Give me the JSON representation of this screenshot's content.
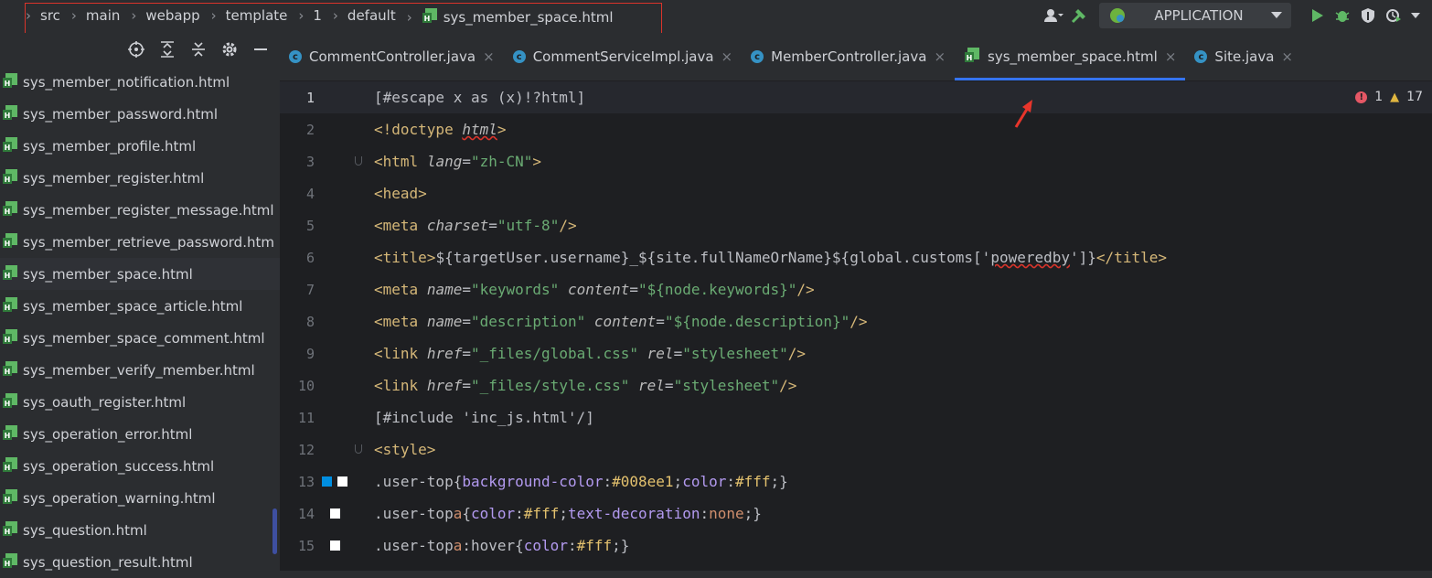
{
  "breadcrumbs": [
    "src",
    "main",
    "webapp",
    "template",
    "1",
    "default",
    "sys_member_space.html"
  ],
  "toolbar": {
    "run_config": "APPLICATION"
  },
  "sidebar": {
    "items": [
      "sys_member_notification.html",
      "sys_member_password.html",
      "sys_member_profile.html",
      "sys_member_register.html",
      "sys_member_register_message.html",
      "sys_member_retrieve_password.htm",
      "sys_member_space.html",
      "sys_member_space_article.html",
      "sys_member_space_comment.html",
      "sys_member_verify_member.html",
      "sys_oauth_register.html",
      "sys_operation_error.html",
      "sys_operation_success.html",
      "sys_operation_warning.html",
      "sys_question.html",
      "sys_question_result.html"
    ],
    "selected_index": 6
  },
  "tabs": [
    {
      "label": "CommentController.java",
      "type": "class"
    },
    {
      "label": "CommentServiceImpl.java",
      "type": "class"
    },
    {
      "label": "MemberController.java",
      "type": "class"
    },
    {
      "label": "sys_member_space.html",
      "type": "html"
    },
    {
      "label": "Site.java",
      "type": "class"
    }
  ],
  "active_tab": 3,
  "inspections": {
    "errors": "1",
    "warnings": "17"
  },
  "code_lines": [
    {
      "n": "1",
      "t": "[#escape x as (x)!?html]"
    },
    {
      "n": "2",
      "t": "<!doctype html>"
    },
    {
      "n": "3",
      "t": "<html lang=\"zh-CN\">"
    },
    {
      "n": "4",
      "t": "<head>"
    },
    {
      "n": "5",
      "t": "<meta charset=\"utf-8\"/>"
    },
    {
      "n": "6",
      "t": "<title>${targetUser.username}_${site.fullNameOrName}${global.customs['poweredby']}</title>"
    },
    {
      "n": "7",
      "t": "<meta name=\"keywords\" content=\"${node.keywords}\"/>"
    },
    {
      "n": "8",
      "t": "<meta name=\"description\" content=\"${node.description}\"/>"
    },
    {
      "n": "9",
      "t": "<link href=\"_files/global.css\" rel=\"stylesheet\"/>"
    },
    {
      "n": "10",
      "t": "<link href=\"_files/style.css\" rel=\"stylesheet\"/>"
    },
    {
      "n": "11",
      "t": "[#include 'inc_js.html'/]"
    },
    {
      "n": "12",
      "t": "<style>"
    },
    {
      "n": "13",
      "t": ".user-top{background-color:#008ee1;color:#fff;}"
    },
    {
      "n": "14",
      "t": ".user-top a{color:#fff;text-decoration:none;}"
    },
    {
      "n": "15",
      "t": ".user-top a:hover{color:#fff;}"
    }
  ],
  "colors": {
    "accent": "#3574f0",
    "highlight_box": "#d9342b",
    "swatch_blue": "#008ee1",
    "swatch_white": "#ffffff"
  }
}
